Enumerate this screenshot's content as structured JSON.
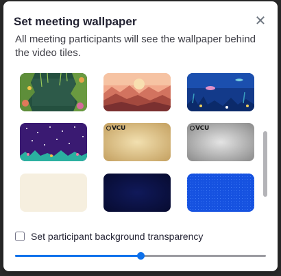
{
  "dialog": {
    "title": "Set meeting wallpaper",
    "close_icon": "close-icon",
    "description": "All meeting participants will see the wallpaper behind the video tiles."
  },
  "wallpapers": [
    {
      "name": "jungle-foliage"
    },
    {
      "name": "desert-sunset"
    },
    {
      "name": "underwater-ocean"
    },
    {
      "name": "purple-night-reef"
    },
    {
      "name": "vcu-parchment",
      "logo_text": "VCU"
    },
    {
      "name": "vcu-gray-texture",
      "logo_text": "VCU"
    },
    {
      "name": "cream-paper"
    },
    {
      "name": "dark-navy"
    },
    {
      "name": "blue-grid"
    }
  ],
  "transparency": {
    "checkbox_label": "Set participant background transparency",
    "checked": false,
    "slider_value": 0.5
  },
  "colors": {
    "accent": "#0e71eb",
    "title": "#232333",
    "scroll_thumb": "#b4b4b8"
  }
}
